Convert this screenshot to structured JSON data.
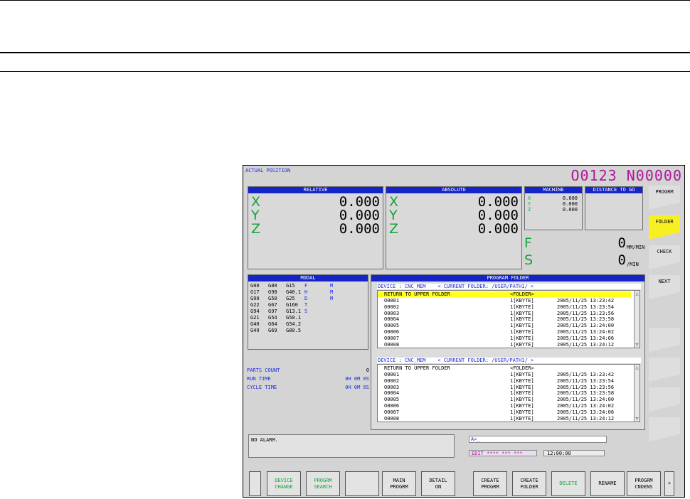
{
  "screen": {
    "title": "ACTUAL POSITION",
    "program_number": "O0123 N00000",
    "relative": {
      "header": "RELATIVE",
      "axes": [
        {
          "axis": "X",
          "value": "0.000"
        },
        {
          "axis": "Y",
          "value": "0.000"
        },
        {
          "axis": "Z",
          "value": "0.000"
        }
      ]
    },
    "absolute": {
      "header": "ABSOLUTE",
      "axes": [
        {
          "axis": "X",
          "value": "0.000"
        },
        {
          "axis": "Y",
          "value": "0.000"
        },
        {
          "axis": "Z",
          "value": "0.000"
        }
      ]
    },
    "machine": {
      "header": "MACHINE",
      "axes": [
        {
          "axis": "X",
          "value": "0.000"
        },
        {
          "axis": "Y",
          "value": "0.000"
        },
        {
          "axis": "Z",
          "value": "0.000"
        }
      ]
    },
    "distance": {
      "header": "DISTANCE TO GO"
    },
    "feed": {
      "letter": "F",
      "value": "0",
      "unit": "MM/MIN"
    },
    "spindle": {
      "letter": "S",
      "value": "0",
      "unit": "/MIN"
    },
    "modal": {
      "header": "MODAL",
      "rows": [
        [
          "G00",
          "G80",
          "G15",
          "F",
          "",
          " M"
        ],
        [
          "G17",
          "G98",
          "G40.1",
          "H",
          "",
          " M"
        ],
        [
          "G90",
          "G50",
          "G25",
          "D",
          "",
          " M"
        ],
        [
          "G22",
          "G67",
          "G160",
          "T",
          "",
          ""
        ],
        [
          "G94",
          "G97",
          "G13.1",
          "S",
          "",
          ""
        ],
        [
          "G21",
          "G54",
          "G50.1",
          "",
          "",
          ""
        ],
        [
          "G40",
          "G64",
          "G54.2",
          "",
          "",
          ""
        ],
        [
          "G49",
          "G69",
          "G80.5",
          "",
          "",
          ""
        ]
      ]
    },
    "counters": [
      {
        "label": "PARTS COUNT",
        "value": "0"
      },
      {
        "label": "RUN TIME",
        "value": "0H 0M 0S"
      },
      {
        "label": "CYCLE TIME",
        "value": "0H 0M 0S"
      }
    ],
    "program_folder": {
      "header": "PROGRAM FOLDER",
      "lists": [
        {
          "device_line": "DEVICE : CNC_MEM    < CURRENT FOLDER: /USER/PATH1/ >",
          "up_row": {
            "name": "RETURN TO UPPER FOLDER",
            "size": "<FOLDER>"
          },
          "files": [
            {
              "name": "O0001",
              "size": "1[KBYTE]",
              "date": "2005/11/25 13:23:42"
            },
            {
              "name": "O0002",
              "size": "1[KBYTE]",
              "date": "2005/11/25 13:23:54"
            },
            {
              "name": "O0003",
              "size": "1[KBYTE]",
              "date": "2005/11/25 13:23:56"
            },
            {
              "name": "O0004",
              "size": "1[KBYTE]",
              "date": "2005/11/25 13:23:58"
            },
            {
              "name": "O0005",
              "size": "1[KBYTE]",
              "date": "2005/11/25 13:24:00"
            },
            {
              "name": "O0006",
              "size": "1[KBYTE]",
              "date": "2005/11/25 13:24:02"
            },
            {
              "name": "O0007",
              "size": "1[KBYTE]",
              "date": "2005/11/25 13:24:06"
            },
            {
              "name": "O0008",
              "size": "1[KBYTE]",
              "date": "2005/11/25 13:24:12"
            }
          ]
        },
        {
          "device_line": "DEVICE : CNC_MEM    < CURRENT FOLDER: /USER/PATH1/ >",
          "up_row": {
            "name": "RETURN TO UPPER FOLDER",
            "size": "<FOLDER>"
          },
          "files": [
            {
              "name": "O0001",
              "size": "1[KBYTE]",
              "date": "2005/11/25 13:23:42"
            },
            {
              "name": "O0002",
              "size": "1[KBYTE]",
              "date": "2005/11/25 13:23:54"
            },
            {
              "name": "O0003",
              "size": "1[KBYTE]",
              "date": "2005/11/25 13:23:56"
            },
            {
              "name": "O0004",
              "size": "1[KBYTE]",
              "date": "2005/11/25 13:23:58"
            },
            {
              "name": "O0005",
              "size": "1[KBYTE]",
              "date": "2005/11/25 13:24:00"
            },
            {
              "name": "O0006",
              "size": "1[KBYTE]",
              "date": "2005/11/25 13:24:02"
            },
            {
              "name": "O0007",
              "size": "1[KBYTE]",
              "date": "2005/11/25 13:24:06"
            },
            {
              "name": "O0008",
              "size": "1[KBYTE]",
              "date": "2005/11/25 13:24:12"
            }
          ]
        }
      ]
    },
    "alarm_message": "NO ALARM.",
    "input_prompt": "A>_",
    "status_mode": "EDIT **** *** ***",
    "status_time": "12:00:00",
    "side_keys": [
      {
        "label": "PROGRM",
        "active": false
      },
      {
        "label": "FOLDER",
        "active": true
      },
      {
        "label": "CHECK",
        "active": false
      },
      {
        "label": "NEXT",
        "active": false
      }
    ],
    "soft_keys": [
      {
        "label": "DEVICE\nCHANGE",
        "color": "#11a53a"
      },
      {
        "label": "PROGRM\nSEARCH",
        "color": "#11a53a"
      },
      {
        "label": "",
        "color": "#000000"
      },
      {
        "label": "MAIN\nPROGRM",
        "color": "#000000"
      },
      {
        "label": "DETAIL\nON",
        "color": "#000000"
      },
      {
        "label": "CREATE\nPROGRM",
        "color": "#000000"
      },
      {
        "label": "CREATE\nFOLDER",
        "color": "#000000"
      },
      {
        "label": "DELETE",
        "color": "#11a53a"
      },
      {
        "label": "RENAME",
        "color": "#000000"
      },
      {
        "label": "PROGRM\nCNDENS",
        "color": "#000000"
      },
      {
        "label": "+",
        "color": "#000000"
      }
    ],
    "colors": {
      "accent_blue": "#1524c8",
      "active_green": "#11a53a",
      "title_magenta": "#b0169c",
      "highlight_yellow": "#ffff20"
    }
  }
}
